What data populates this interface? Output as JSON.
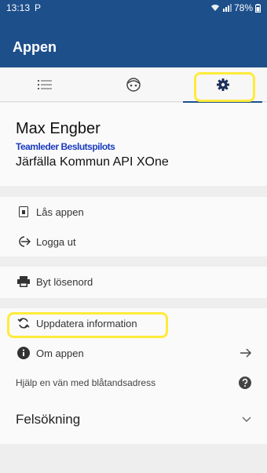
{
  "status_bar": {
    "time": "13:13",
    "notification": "P",
    "battery": "78%"
  },
  "app_bar": {
    "title": "Appen"
  },
  "tabs": [
    {
      "icon": "list-icon",
      "active": false
    },
    {
      "icon": "face-icon",
      "active": false
    },
    {
      "icon": "gear-icon",
      "active": true
    }
  ],
  "profile": {
    "name": "Max Engber",
    "subtitle": "Teamleder Beslutspilots",
    "org": "Järfälla Kommun API XOne"
  },
  "menu": {
    "lock": "Lås appen",
    "logout": "Logga ut",
    "change_password": "Byt lösenord",
    "update_info": "Uppdatera information",
    "about": "Om appen",
    "help_friend": "Hjälp en vän med blåtandsadress",
    "troubleshooting": "Felsökning"
  },
  "colors": {
    "app_bar": "#1d4f8b",
    "highlight": "#ffeb3b"
  }
}
